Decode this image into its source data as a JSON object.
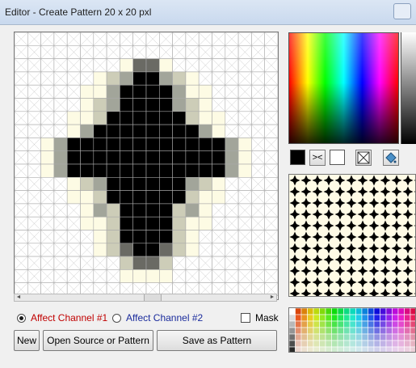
{
  "window": {
    "title": "Editor - Create Pattern 20 x 20 pxl"
  },
  "pattern": {
    "grid_size": 20,
    "rows": [
      "....................",
      "....................",
      "........ADDA........",
      "......ACBXXBCA......",
      ".....AABXXXXBAA.....",
      ".....ACBXXXXBCA.....",
      "....AACXXXXXXCAA....",
      "....ABXXXXXXXXBA....",
      "..ABXXXXXXXXXXXXBA..",
      "..ABXXXXXXXXXXXXBA..",
      "..ABXXXXXXXXXXXXBA..",
      "....ACBXXXXXXBCA....",
      "....AACXXXXXXCAA....",
      ".....ABCXXXXCBA.....",
      ".....AACXXXXCAA.....",
      "......ACXXXXCA......",
      "......ACDXXDCA......",
      "........CDDC........",
      "........AAAA........",
      "...................."
    ],
    "colors": {
      ".": "#ffffff",
      "A": "#fdfbe4",
      "B": "#a2a59a",
      "C": "#cdcdb8",
      "D": "#6a6a64",
      "X": "#000000"
    }
  },
  "channels": {
    "channel1": {
      "label": "Affect Channel #1",
      "color": "#c00000",
      "checked": true
    },
    "channel2": {
      "label": "Affect Channel #2",
      "color": "#1a2b9c",
      "checked": false
    }
  },
  "mask": {
    "label": "Mask",
    "checked": false
  },
  "buttons": {
    "new": "New",
    "open": "Open Source or Pattern",
    "save": "Save as Pattern"
  },
  "tools": {
    "swap_label": "><",
    "foreground_color": "#000000",
    "background_color": "#ffffff"
  }
}
